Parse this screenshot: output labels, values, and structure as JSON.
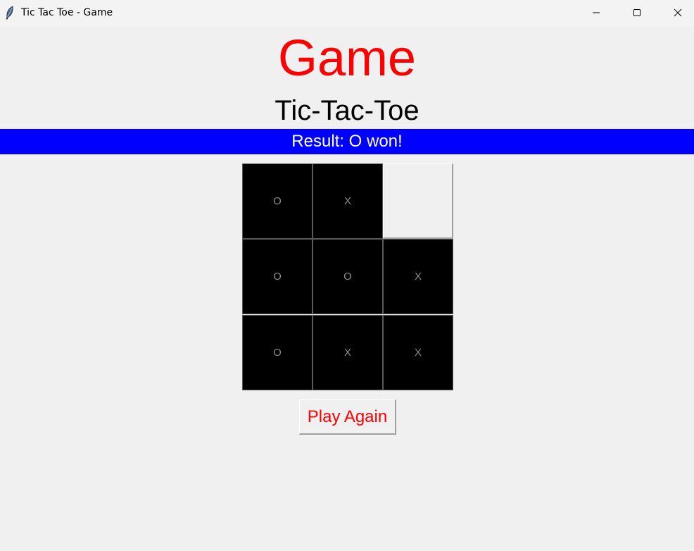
{
  "window": {
    "title": "Tic Tac Toe - Game",
    "icon": "feather-icon",
    "controls": [
      "minimize-icon",
      "maximize-icon",
      "close-icon"
    ]
  },
  "header": {
    "title": "Game",
    "subtitle": "Tic-Tac-Toe",
    "title_color": "#ff0000"
  },
  "result": {
    "text": "Result: O won!",
    "background": "#0000ff"
  },
  "board": {
    "cells": [
      [
        "O",
        "X",
        ""
      ],
      [
        "O",
        "O",
        "X"
      ],
      [
        "O",
        "X",
        "X"
      ]
    ]
  },
  "actions": {
    "play_again_label": "Play Again"
  }
}
